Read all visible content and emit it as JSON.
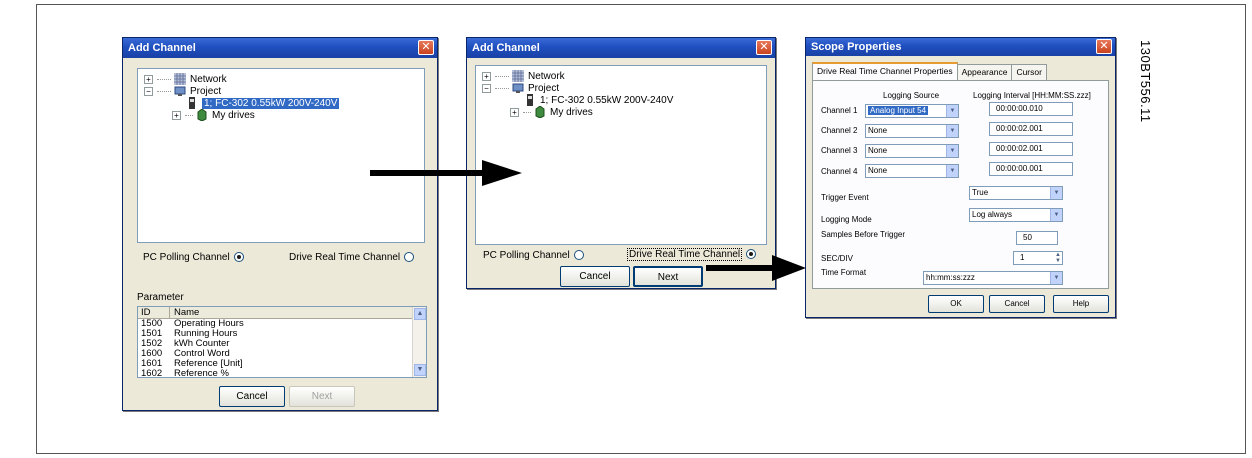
{
  "figure_id": "130BT556.11",
  "window1": {
    "title": "Add Channel",
    "tree": {
      "network": "Network",
      "project": "Project",
      "drive": "1; FC-302 0.55kW 200V-240V",
      "my_drives": "My drives"
    },
    "pc_polling_label": "PC Polling Channel",
    "drive_rt_label": "Drive Real Time Channel",
    "pc_polling_selected": true,
    "parameter_label": "Parameter",
    "columns": [
      "ID",
      "Name"
    ],
    "rows": [
      {
        "id": "1500",
        "name": "Operating Hours"
      },
      {
        "id": "1501",
        "name": "Running Hours"
      },
      {
        "id": "1502",
        "name": "kWh Counter"
      },
      {
        "id": "1600",
        "name": "Control Word"
      },
      {
        "id": "1601",
        "name": "Reference [Unit]"
      },
      {
        "id": "1602",
        "name": "Reference %"
      }
    ],
    "cancel": "Cancel",
    "next": "Next"
  },
  "window2": {
    "title": "Add Channel",
    "tree": {
      "network": "Network",
      "project": "Project",
      "drive": "1; FC-302 0.55kW 200V-240V",
      "my_drives": "My drives"
    },
    "pc_polling_label": "PC Polling Channel",
    "drive_rt_label": "Drive Real Time Channel",
    "drive_rt_selected": true,
    "cancel": "Cancel",
    "next": "Next"
  },
  "window3": {
    "title": "Scope Properties",
    "tabs": [
      "Drive Real Time Channel Properties",
      "Appearance",
      "Cursor"
    ],
    "logging_source_header": "Logging Source",
    "logging_interval_header": "Logging Interval [HH:MM:SS.zzz]",
    "channels": [
      {
        "label": "Channel 1",
        "source": "Analog Input 54",
        "interval": "00:00:00.010"
      },
      {
        "label": "Channel 2",
        "source": "None",
        "interval": "00:00:02.001"
      },
      {
        "label": "Channel 3",
        "source": "None",
        "interval": "00:00:02.001"
      },
      {
        "label": "Channel 4",
        "source": "None",
        "interval": "00:00:00.001"
      }
    ],
    "trigger_event_label": "Trigger Event",
    "trigger_event_value": "True",
    "logging_mode_label": "Logging Mode",
    "logging_mode_value": "Log always",
    "samples_before_trigger_label": "Samples Before Trigger",
    "samples_before_trigger_value": "50",
    "sec_div_label": "SEC/DIV",
    "sec_div_value": "1",
    "time_format_label": "Time Format",
    "time_format_value": "hh:mm:ss:zzz",
    "ok": "OK",
    "cancel": "Cancel",
    "help": "Help"
  }
}
